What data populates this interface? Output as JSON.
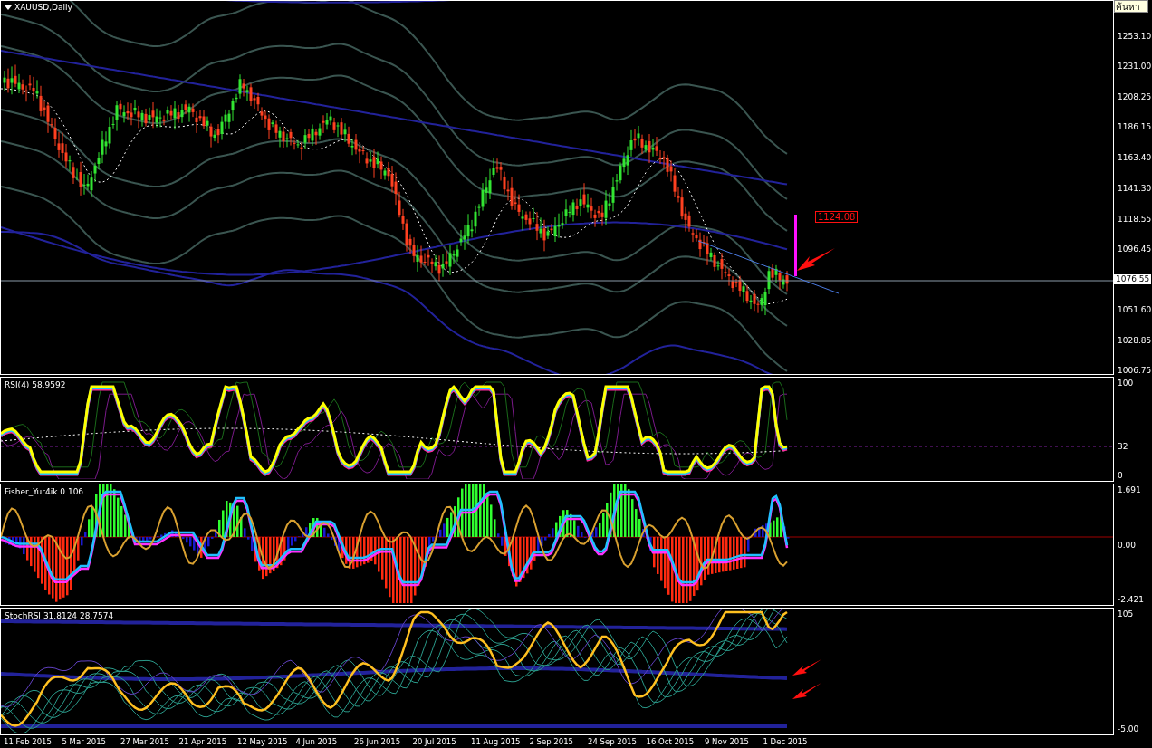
{
  "main_chart": {
    "title": "XAUUSD,Daily",
    "search": {
      "placeholder": "ค้นหา"
    },
    "price_axis": [
      "1253.10",
      "1231.00",
      "1208.25",
      "1186.15",
      "1163.40",
      "1141.30",
      "1118.55",
      "1096.45",
      "1051.60",
      "1028.85",
      "1006.75"
    ],
    "current_price": "1076.55",
    "price_label": "1124.08"
  },
  "indicators": [
    {
      "kind": "rsi",
      "label": "RSI(4) 58.9592",
      "axis": [
        "100",
        "32",
        "0"
      ]
    },
    {
      "kind": "fisher",
      "label": "Fisher_Yur4ik 0.106",
      "axis": [
        "1.691",
        "0.00",
        "-2.421"
      ]
    },
    {
      "kind": "stoch",
      "label": "StochRSI 31.8124 28.7574",
      "axis": [
        "105",
        "-5.00"
      ]
    }
  ],
  "date_axis": [
    "11 Feb 2015",
    "5 Mar 2015",
    "27 Mar 2015",
    "21 Apr 2015",
    "12 May 2015",
    "4 Jun 2015",
    "26 Jun 2015",
    "20 Jul 2015",
    "11 Aug 2015",
    "2 Sep 2015",
    "24 Sep 2015",
    "16 Oct 2015",
    "9 Nov 2015",
    "1 Dec 2015"
  ]
}
